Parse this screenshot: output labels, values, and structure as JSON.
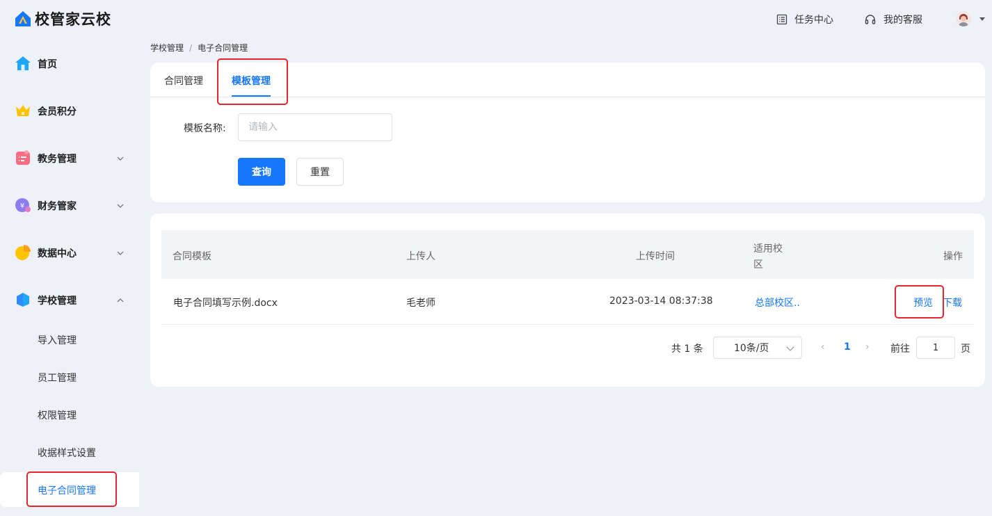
{
  "app": {
    "name": "校管家云校"
  },
  "header": {
    "task_center": "任务中心",
    "customer_service": "我的客服"
  },
  "sidebar": {
    "items": [
      {
        "label": "首页",
        "icon": "home-icon"
      },
      {
        "label": "会员积分",
        "icon": "crown-icon"
      },
      {
        "label": "教务管理",
        "icon": "calendar-icon",
        "expandable": true
      },
      {
        "label": "财务管家",
        "icon": "coin-icon",
        "expandable": true
      },
      {
        "label": "数据中心",
        "icon": "pie-chart-icon",
        "expandable": true
      },
      {
        "label": "学校管理",
        "icon": "school-icon",
        "expandable": true,
        "expanded": true
      }
    ],
    "sub_items": [
      "导入管理",
      "员工管理",
      "权限管理",
      "收据样式设置",
      "电子合同管理"
    ],
    "active_sub_item": "电子合同管理"
  },
  "breadcrumb": [
    "学校管理",
    "电子合同管理"
  ],
  "tabs": {
    "contract": "合同管理",
    "template": "模板管理",
    "active": "模板管理"
  },
  "filter": {
    "label": "模板名称:",
    "placeholder": "请输入",
    "value": "",
    "query_button": "查询",
    "reset_button": "重置"
  },
  "table": {
    "columns": {
      "template": "合同模板",
      "uploader": "上传人",
      "upload_time": "上传时间",
      "campus_line1": "适用校",
      "campus_line2": "区",
      "action": "操作"
    },
    "rows": [
      {
        "template": "电子合同填写示例.docx",
        "uploader": "毛老师",
        "upload_time": "2023-03-14 08:37:38",
        "campus": "总部校区..",
        "preview": "预览",
        "download": "下载"
      }
    ]
  },
  "pagination": {
    "total": "共 1 条",
    "page_size": "10条/页",
    "current_page": "1",
    "goto_label": "前往",
    "goto_value": "1",
    "unit": "页"
  },
  "colors": {
    "accent": "#1677ff",
    "highlight_box": "#e8242d",
    "background": "#eef1f8"
  }
}
